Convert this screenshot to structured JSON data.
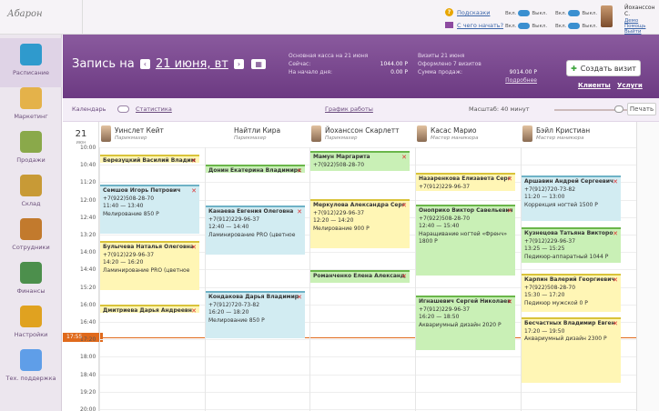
{
  "logo": "Абарон",
  "top": {
    "help": "Подсказки",
    "start": "С чего начать?",
    "toggle1": {
      "on": "Вкл.",
      "off": "Выкл."
    },
    "toggle2": {
      "on": "Вкл.",
      "off": "Выкл."
    },
    "toggle3": {
      "on": "Вкл.",
      "off": "Выкл."
    },
    "toggle4": {
      "on": "Вкл.",
      "off": "Выкл."
    },
    "user": {
      "name": "Йоханссон С.",
      "demo": "Демо",
      "help": "Помощь",
      "exit": "Выйти"
    }
  },
  "sidebar": [
    {
      "label": "Расписание",
      "color": "#2f9acd"
    },
    {
      "label": "Маркетинг",
      "color": "#e4b24a"
    },
    {
      "label": "Продажи",
      "color": "#8aa94a"
    },
    {
      "label": "Склад",
      "color": "#c89a36"
    },
    {
      "label": "Сотрудники",
      "color": "#c27a2d"
    },
    {
      "label": "Финансы",
      "color": "#4c8f4c"
    },
    {
      "label": "Настройки",
      "color": "#e0a220"
    },
    {
      "label": "Тех. поддержка",
      "color": "#5f9ee8"
    }
  ],
  "header": {
    "title": "Запись на",
    "date": "21 июня, вт",
    "cash": {
      "title": "Основная касса на 21 июня",
      "now_label": "Сейчас:",
      "now_value": "1044.00 Р",
      "start_label": "На начало дня:",
      "start_value": "0.00 Р"
    },
    "visits": {
      "title": "Визиты 21 июня",
      "done": "Оформлено 7 визитов",
      "sum_label": "Сумма продаж:",
      "sum_value": "9014.00 Р",
      "more": "Подробнее"
    },
    "create": "Создать визит",
    "clients": "Клиенты",
    "services": "Услуги"
  },
  "subbar": {
    "calendar": "Календарь",
    "stats": "Статистика",
    "schedule": "График работы",
    "scale": "Масштаб: 40 минут",
    "print": "Печать"
  },
  "day": {
    "num": "21",
    "month": "июн"
  },
  "times": [
    "10:00",
    "10:40",
    "11:20",
    "12:00",
    "12:40",
    "13:20",
    "14:00",
    "14:40",
    "15:20",
    "16:00",
    "16:40",
    "17:20",
    "18:00",
    "18:40",
    "19:20",
    "20:00"
  ],
  "now": "17:55",
  "staff": [
    {
      "name": "Уинслет Кейт",
      "role": "Парикмахер"
    },
    {
      "name": "Найтли Кира",
      "role": "Парикмахер"
    },
    {
      "name": "Йоханссон Скарлетт",
      "role": "Парикмахер"
    },
    {
      "name": "Касас Марио",
      "role": "Мастер маникюра"
    },
    {
      "name": "Бэйл Кристиан",
      "role": "Мастер маникюра"
    }
  ],
  "appts": [
    {
      "col": 0,
      "name": "Березуцкий Василий Владим",
      "phone": "",
      "time": "",
      "service": "",
      "color": "yellow"
    },
    {
      "col": 0,
      "name": "Семшов Игорь Петрович",
      "phone": "+7(922)508-28-70",
      "time": "11:40 — 13:40",
      "service": "Мелирование 850 Р",
      "color": "blue"
    },
    {
      "col": 0,
      "name": "Булычева Наталья Олеговна",
      "phone": "+7(912)229-96-37",
      "time": "14:20 — 16:20",
      "service": "Ламинирование PRO (цветное",
      "color": "yellow"
    },
    {
      "col": 0,
      "name": "Дмитриева Дарья Андреевн",
      "phone": "",
      "time": "",
      "service": "",
      "color": "yellow"
    },
    {
      "col": 1,
      "name": "Донин Екатерина Владимирс",
      "phone": "",
      "time": "",
      "service": "",
      "color": "green"
    },
    {
      "col": 1,
      "name": "Канаева Евгения Олеговна",
      "phone": "+7(912)229-96-37",
      "time": "12:40 — 14:40",
      "service": "Ламинирование PRO (цветное",
      "color": "blue"
    },
    {
      "col": 1,
      "name": "Кондакова Дарья Владимир",
      "phone": "+7(912)720-73-82",
      "time": "16:20 — 18:20",
      "service": "Мелирование 850 Р",
      "color": "blue"
    },
    {
      "col": 2,
      "name": "Мамун Маргарита",
      "phone": "+7(922)508-28-70",
      "time": "",
      "service": "",
      "color": "green"
    },
    {
      "col": 2,
      "name": "Меркулова Александра Серг",
      "phone": "+7(912)229-96-37",
      "time": "12:20 — 14:20",
      "service": "Мелирование 900 Р",
      "color": "yellow"
    },
    {
      "col": 2,
      "name": "Романченко Елена Александ",
      "phone": "",
      "time": "",
      "service": "",
      "color": "green"
    },
    {
      "col": 3,
      "name": "Назаренкова Елизавета Серг",
      "phone": "+7(912)229-96-37",
      "time": "",
      "service": "",
      "color": "yellow"
    },
    {
      "col": 3,
      "name": "Оноприко Виктор Савельевич",
      "phone": "+7(922)508-28-70",
      "time": "12:40 — 15:40",
      "service": "Наращивание ногтей «Френч»",
      "price": "1800 Р",
      "color": "green"
    },
    {
      "col": 3,
      "name": "Игнашевич Сергей Николаев",
      "phone": "+7(912)229-96-37",
      "time": "16:20 — 18:50",
      "service": "Аквариумный дизайн 2020 Р",
      "color": "green"
    },
    {
      "col": 4,
      "name": "Аршавин Андрей Сергеевич",
      "phone": "+7(912)720-73-82",
      "time": "11:20 — 13:00",
      "service": "Коррекция ногтей 1500 Р",
      "color": "blue"
    },
    {
      "col": 4,
      "name": "Кузнецова Татьяна Викторо",
      "phone": "+7(912)229-96-37",
      "time": "13:25 — 15:25",
      "service": "Педикюр-аппаратный 1044 Р",
      "color": "green"
    },
    {
      "col": 4,
      "name": "Карпин Валерий Георгиевич",
      "phone": "+7(922)508-28-70",
      "time": "15:30 — 17:20",
      "service": "Педикюр мужской 0 Р",
      "color": "yellow"
    },
    {
      "col": 4,
      "name": "Бесчастных Владимир Евген",
      "phone": "",
      "time": "17:20 — 19:50",
      "service": "Аквариумный дизайн 2300 Р",
      "color": "yellow"
    }
  ]
}
